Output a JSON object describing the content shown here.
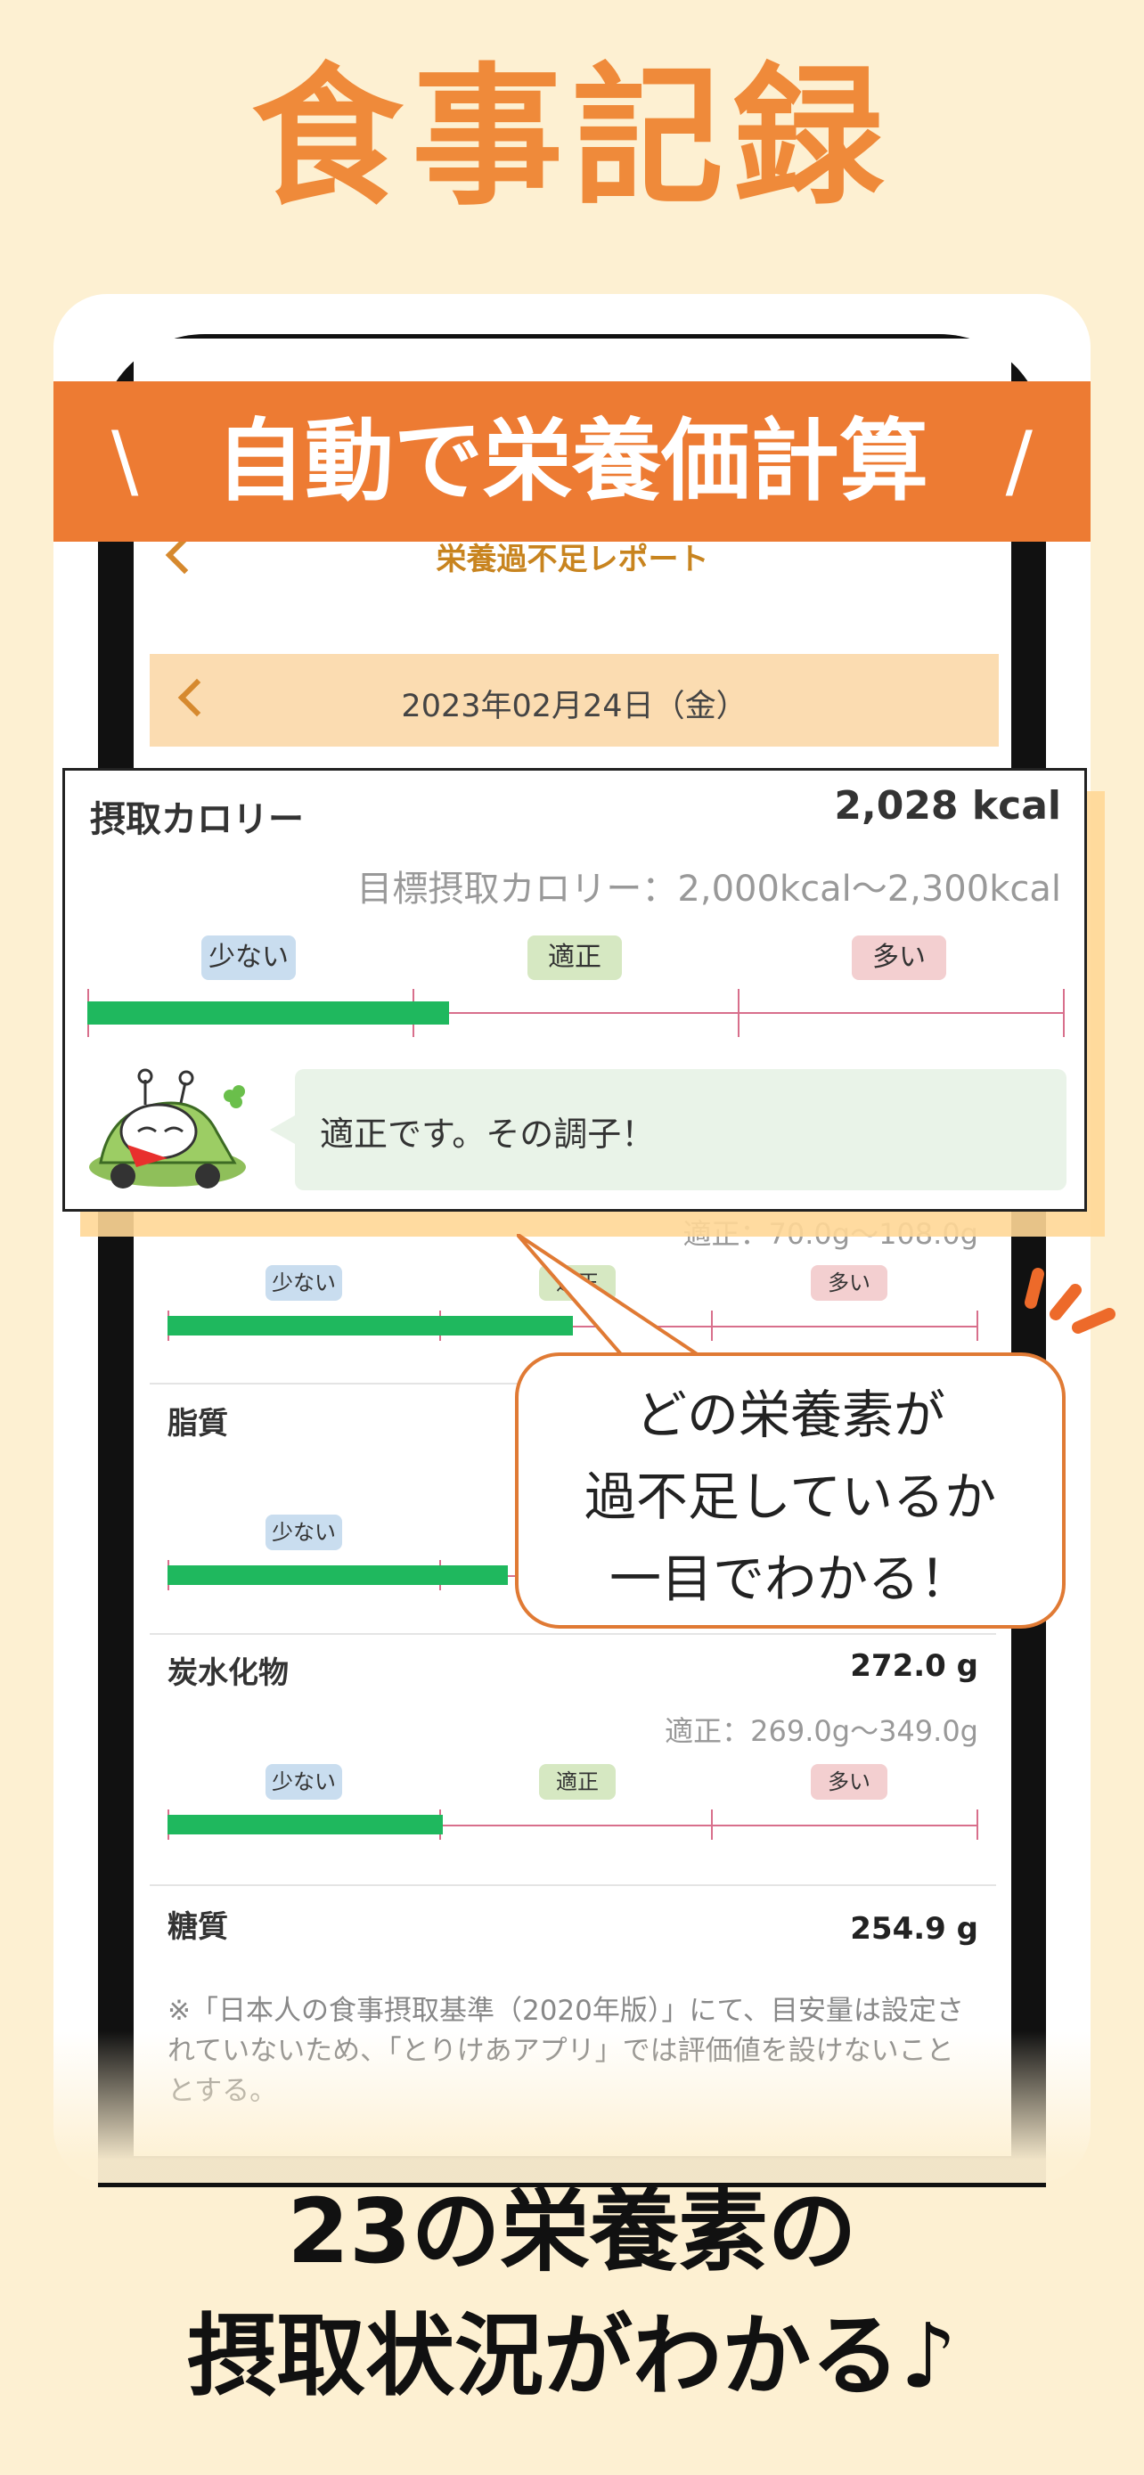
{
  "headline": "食事記録",
  "banner": {
    "slash_left": "\\",
    "text": "自動で栄養価計算",
    "slash_right": "/"
  },
  "screen": {
    "title": "栄養過不足レポート",
    "date": "2023年02月24日（金）",
    "pill_low": "少ない",
    "pill_ok": "適正",
    "pill_high": "多い",
    "protein_range": "適正：70.0g〜108.0g",
    "fat_label": "脂質",
    "carb_label": "炭水化物",
    "carb_value": "272.0 g",
    "carb_range": "適正：269.0g〜349.0g",
    "sugar_label": "糖質",
    "sugar_value": "254.9 g",
    "note": "※「日本人の食事摂取基準（2020年版）」にて、目安量は設定されていないため、「とりけあアプリ」では評価値を設けないこととする。"
  },
  "calorie_card": {
    "label": "摂取カロリー",
    "value": "2,028 kcal",
    "target": "目標摂取カロリー：2,000kcal〜2,300kcal",
    "pill_low": "少ない",
    "pill_ok": "適正",
    "pill_high": "多い",
    "message": "適正です。その調子！"
  },
  "callout": {
    "line1": "どの栄養素が",
    "line2": "過不足しているか",
    "line3": "一目でわかる！"
  },
  "bottom": {
    "line1": "23の栄養素の",
    "line2": "摂取状況がわかる♪"
  },
  "levels": {
    "calorie": 0.37,
    "protein": 0.5,
    "fat": 0.42,
    "carb": 0.34
  },
  "colors": {
    "background": "#fdf0d2",
    "accent": "#ed7b33",
    "fill": "#1fb85e",
    "track": "#d86f8c"
  }
}
